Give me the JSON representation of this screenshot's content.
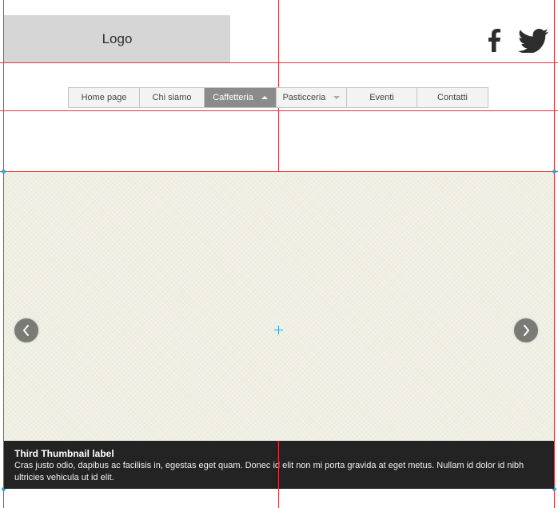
{
  "header": {
    "logo_text": "Logo",
    "social": [
      {
        "icon": "facebook-icon"
      },
      {
        "icon": "twitter-icon"
      }
    ]
  },
  "nav": {
    "items": [
      {
        "label": "Home page",
        "active": false,
        "caret": null
      },
      {
        "label": "Chi siamo",
        "active": false,
        "caret": null
      },
      {
        "label": "Caffetteria",
        "active": true,
        "caret": "up"
      },
      {
        "label": "Pasticceria",
        "active": false,
        "caret": "down"
      },
      {
        "label": "Eventi",
        "active": false,
        "caret": null
      },
      {
        "label": "Contatti",
        "active": false,
        "caret": null
      }
    ]
  },
  "carousel": {
    "prev_icon": "chevron-left-icon",
    "next_icon": "chevron-right-icon",
    "caption": {
      "title": "Third Thumbnail label",
      "text": "Cras justo odio, dapibus ac facilisis in, egestas eget quam. Donec id elit non mi porta gravida at eget metus. Nullam id dolor id nibh ultricies vehicula ut id elit."
    }
  },
  "colors": {
    "guide": "#e8343b",
    "guide_node": "#29a8e0",
    "nav_active_bg": "#8b8b8b",
    "carousel_bg": "#efeee2",
    "caption_bg": "#232323"
  }
}
